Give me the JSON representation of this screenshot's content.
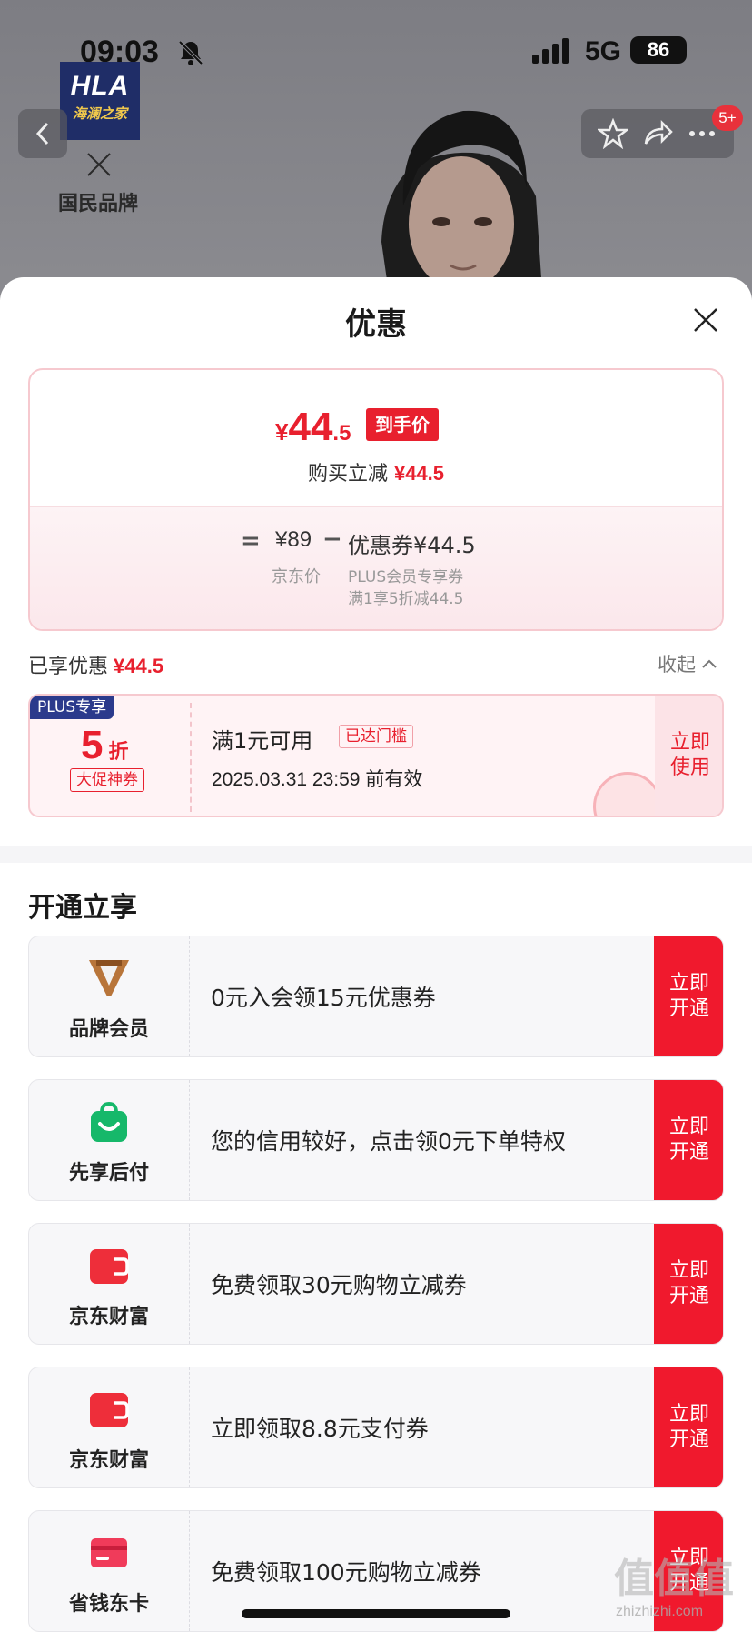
{
  "status_bar": {
    "time": "09:03",
    "network": "5G",
    "battery": "86"
  },
  "background_page": {
    "brand_logo_line1": "HLA",
    "brand_logo_line2": "海澜之家",
    "brand_slogan": "国民品牌",
    "notification_badge": "5+"
  },
  "sheet": {
    "title": "优惠",
    "price_card": {
      "currency": "¥",
      "price_int": "44",
      "price_dec": ".5",
      "price_tag": "到手价",
      "discount_text": "购买立减",
      "discount_amount": "¥44.5",
      "calc_eq": "=",
      "jd_price": "¥89",
      "jd_price_label": "京东价",
      "calc_minus": "−",
      "coupon_amount": "优惠券¥44.5",
      "coupon_desc1": "PLUS会员专享券",
      "coupon_desc2": "满1享5折减44.5"
    },
    "enjoyed": {
      "label": "已享优惠",
      "amount": "¥44.5",
      "collapse_label": "收起"
    },
    "coupon": {
      "plus_tag": "PLUS专享",
      "discount_num": "5",
      "discount_unit": "折",
      "type": "大促神券",
      "condition": "满1元可用",
      "threshold_tag": "已达门槛",
      "validity": "2025.03.31 23:59 前有效",
      "use_button": "立即使用"
    },
    "section_title": "开通立享",
    "offers": [
      {
        "name": "品牌会员",
        "icon": "brand-v-icon",
        "desc": "0元入会领15元优惠券",
        "button": "立即开通"
      },
      {
        "name": "先享后付",
        "icon": "shopping-bag-icon",
        "desc": "您的信用较好，点击领0元下单特权",
        "button": "立即开通"
      },
      {
        "name": "京东财富",
        "icon": "wallet-icon",
        "desc": "免费领取30元购物立减券",
        "button": "立即开通"
      },
      {
        "name": "京东财富",
        "icon": "wallet-icon",
        "desc": "立即领取8.8元支付券",
        "button": "立即开通"
      },
      {
        "name": "省钱东卡",
        "icon": "card-icon",
        "desc": "免费领取100元购物立减券",
        "button": "立即开通"
      }
    ]
  },
  "watermark": {
    "text": "值值值",
    "url": "zhizhizhi.com"
  },
  "colors": {
    "accent_red": "#e8202e",
    "button_red": "#f0192d",
    "plus_blue": "#2b3a8c"
  }
}
